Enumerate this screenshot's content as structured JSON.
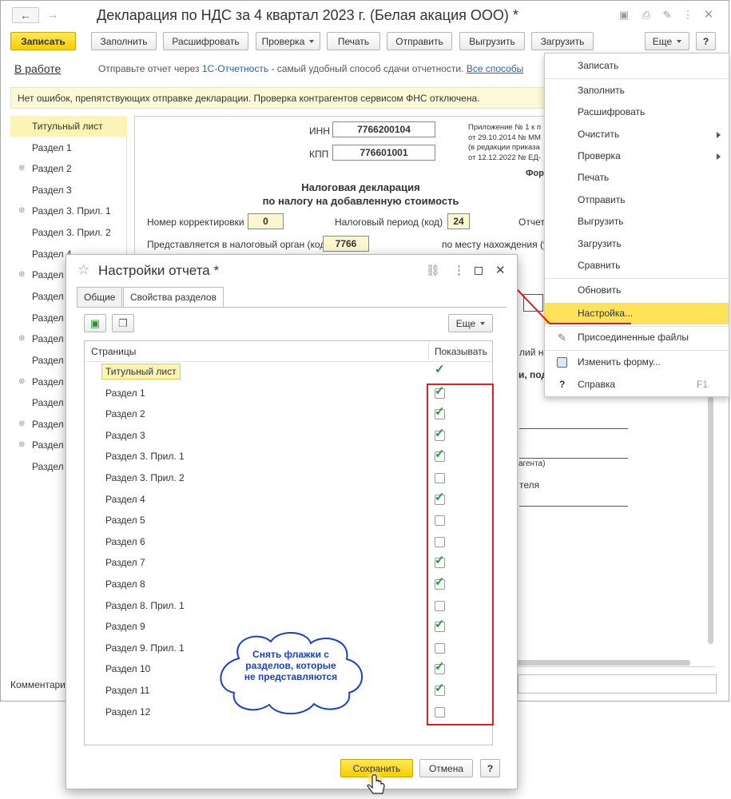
{
  "window": {
    "title": "Декларация по НДС за 4 квартал 2023 г. (Белая акация ООО) *"
  },
  "toolbar": {
    "save": "Записать",
    "fill": "Заполнить",
    "decode": "Расшифровать",
    "check": "Проверка",
    "print": "Печать",
    "send": "Отправить",
    "export": "Выгрузить",
    "import": "Загрузить",
    "more": "Еще",
    "help": "?"
  },
  "status_bar": {
    "state": "В работе",
    "send_prefix": "Отправьте отчет через",
    "send_link": "1С-Отчетность",
    "send_suffix": "- самый удобный способ сдачи отчетности.",
    "all_ways": "Все способы"
  },
  "notice": "Нет ошибок, препятствующих отправке декларации. Проверка контрагентов сервисом ФНС отключена.",
  "sidebar": {
    "items": [
      {
        "label": "Титульный лист",
        "expandable": false,
        "active": true
      },
      {
        "label": "Раздел 1",
        "expandable": false
      },
      {
        "label": "Раздел 2",
        "expandable": true
      },
      {
        "label": "Раздел 3",
        "expandable": false
      },
      {
        "label": "Раздел 3. Прил. 1",
        "expandable": true
      },
      {
        "label": "Раздел 3. Прил. 2",
        "expandable": false
      },
      {
        "label": "Раздел 4",
        "expandable": false
      },
      {
        "label": "Раздел 5",
        "expandable": true
      },
      {
        "label": "Раздел 6",
        "expandable": false
      },
      {
        "label": "Раздел 7",
        "expandable": false
      },
      {
        "label": "Раздел 8",
        "expandable": true
      },
      {
        "label": "Раздел 8. Прил. 1",
        "expandable": false
      },
      {
        "label": "Раздел 9",
        "expandable": true
      },
      {
        "label": "Раздел 9. Прил. 1",
        "expandable": false
      },
      {
        "label": "Раздел 10",
        "expandable": true
      },
      {
        "label": "Раздел 11",
        "expandable": true
      },
      {
        "label": "Раздел 12",
        "expandable": false
      }
    ]
  },
  "form": {
    "inn_label": "ИНН",
    "inn": "7766200104",
    "kpp_label": "КПП",
    "kpp": "776601001",
    "appendix_lines": [
      "Приложение № 1 к п",
      "от 29.10.2014 № ММ",
      "(в редакции приказа",
      "от 12.12.2022 № ЕД-"
    ],
    "form_partial": "Фор",
    "heading_1": "Налоговая декларация",
    "heading_2": "по налогу на добавленную стоимость",
    "correction_label": "Номер корректировки",
    "correction_value": "0",
    "period_label": "Налоговый период (код)",
    "period_value": "24",
    "report_partial": "Отчет",
    "tax_authority_label": "Представляется в налоговый орган (код)",
    "tax_authority_value": "7766",
    "location_partial": "по месту нахождения (уч",
    "partial_1": "лий на",
    "partial_2": "и, под",
    "partial_3": "агента)",
    "partial_4": "теля",
    "comment_label": "Комментари"
  },
  "more_menu": {
    "items": [
      {
        "label": "Записать",
        "icon": ""
      },
      {
        "label": "Заполнить",
        "icon": ""
      },
      {
        "label": "Расшифровать",
        "icon": ""
      },
      {
        "label": "Очистить",
        "icon": "",
        "submenu": true
      },
      {
        "label": "Проверка",
        "icon": "",
        "submenu": true
      },
      {
        "label": "Печать",
        "icon": ""
      },
      {
        "label": "Отправить",
        "icon": ""
      },
      {
        "label": "Выгрузить",
        "icon": ""
      },
      {
        "label": "Загрузить",
        "icon": ""
      },
      {
        "label": "Сравнить",
        "icon": ""
      },
      {
        "label": "Обновить",
        "icon": ""
      },
      {
        "label": "Настройка...",
        "icon": "",
        "highlighted": true
      },
      {
        "label": "Присоединенные файлы",
        "icon": "paperclip-icon"
      },
      {
        "label": "Изменить форму...",
        "icon": "form-icon"
      },
      {
        "label": "Справка",
        "icon": "question-icon",
        "shortcut": "F1"
      }
    ]
  },
  "dialog": {
    "title": "Настройки отчета *",
    "tabs": [
      "Общие",
      "Свойства разделов"
    ],
    "active_tab": 1,
    "more": "Еще",
    "col_pages": "Страницы",
    "col_show": "Показывать",
    "rows": [
      {
        "name": "Титульный лист",
        "checked": true,
        "locked": true
      },
      {
        "name": "Раздел 1",
        "checked": true
      },
      {
        "name": "Раздел 2",
        "checked": true
      },
      {
        "name": "Раздел 3",
        "checked": true
      },
      {
        "name": "Раздел 3. Прил. 1",
        "checked": true
      },
      {
        "name": "Раздел 3. Прил. 2",
        "checked": false
      },
      {
        "name": "Раздел 4",
        "checked": true
      },
      {
        "name": "Раздел 5",
        "checked": false
      },
      {
        "name": "Раздел 6",
        "checked": false
      },
      {
        "name": "Раздел 7",
        "checked": true
      },
      {
        "name": "Раздел 8",
        "checked": true
      },
      {
        "name": "Раздел 8. Прил. 1",
        "checked": false
      },
      {
        "name": "Раздел 9",
        "checked": true
      },
      {
        "name": "Раздел 9. Прил. 1",
        "checked": false
      },
      {
        "name": "Раздел 10",
        "checked": true
      },
      {
        "name": "Раздел 11",
        "checked": true
      },
      {
        "name": "Раздел 12",
        "checked": false
      }
    ],
    "save": "Сохранить",
    "cancel": "Отмена",
    "help": "?"
  },
  "callout": {
    "line1": "Снять флажки с",
    "line2": "разделов, которые",
    "line3": "не представляются"
  },
  "colors": {
    "accent_yellow": "#f5d000",
    "highlight_red": "#e02020",
    "check_green": "#1f9a3f",
    "callout_blue": "#1a3fd0"
  }
}
